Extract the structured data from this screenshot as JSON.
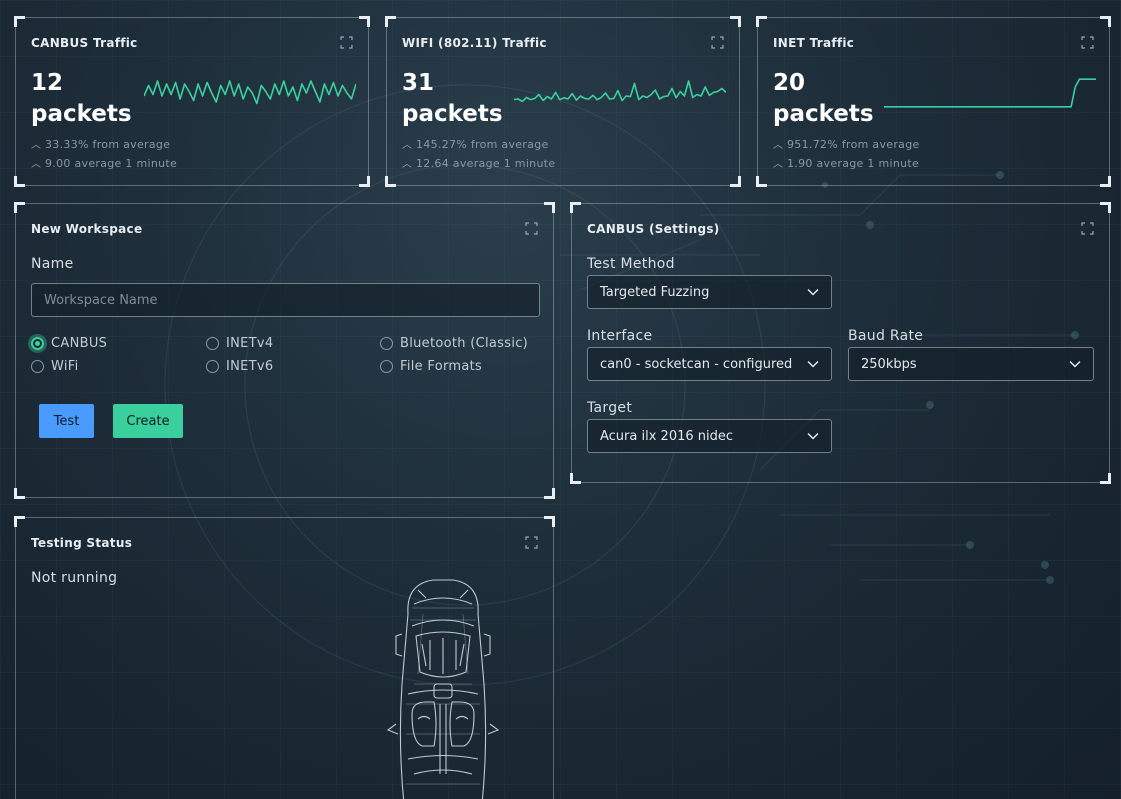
{
  "traffic_cards": [
    {
      "title": "CANBUS Traffic",
      "count": "12",
      "unit": "packets",
      "stat1": "33.33% from average",
      "stat2": "9.00 average 1 minute",
      "sparkline": [
        0.6,
        0.25,
        0.55,
        0.1,
        0.6,
        0.2,
        0.55,
        0.15,
        0.7,
        0.2,
        0.45,
        0.75,
        0.2,
        0.6,
        0.15,
        0.5,
        0.8,
        0.25,
        0.55,
        0.1,
        0.6,
        0.2,
        0.7,
        0.3,
        0.5,
        0.85,
        0.25,
        0.45,
        0.7,
        0.2,
        0.55,
        0.1,
        0.6,
        0.3,
        0.75,
        0.2,
        0.5,
        0.1,
        0.45,
        0.8,
        0.2,
        0.55,
        0.15,
        0.6,
        0.25,
        0.5,
        0.7,
        0.2
      ]
    },
    {
      "title": "WIFI (802.11) Traffic",
      "count": "31",
      "unit": "packets",
      "stat1": "145.27% from average",
      "stat2": "12.64 average 1 minute",
      "sparkline": [
        0.72,
        0.7,
        0.78,
        0.65,
        0.72,
        0.68,
        0.55,
        0.75,
        0.62,
        0.7,
        0.48,
        0.72,
        0.66,
        0.7,
        0.52,
        0.74,
        0.6,
        0.68,
        0.7,
        0.58,
        0.72,
        0.65,
        0.5,
        0.7,
        0.68,
        0.42,
        0.75,
        0.6,
        0.62,
        0.18,
        0.72,
        0.6,
        0.65,
        0.55,
        0.4,
        0.7,
        0.62,
        0.6,
        0.35,
        0.66,
        0.45,
        0.6,
        0.1,
        0.65,
        0.55,
        0.6,
        0.3,
        0.58,
        0.48,
        0.45,
        0.35,
        0.48
      ]
    },
    {
      "title": "INET Traffic",
      "count": "20",
      "unit": "packets",
      "stat1": "951.72% from average",
      "stat2": "1.90 average 1 minute",
      "sparkline": [
        0.96,
        0.96,
        0.96,
        0.96,
        0.96,
        0.96,
        0.96,
        0.96,
        0.96,
        0.96,
        0.96,
        0.96,
        0.96,
        0.96,
        0.96,
        0.96,
        0.96,
        0.96,
        0.96,
        0.96,
        0.96,
        0.96,
        0.96,
        0.96,
        0.96,
        0.96,
        0.96,
        0.96,
        0.96,
        0.96,
        0.96,
        0.96,
        0.96,
        0.96,
        0.96,
        0.96,
        0.96,
        0.96,
        0.96,
        0.96,
        0.96,
        0.96,
        0.96,
        0.96,
        0.96,
        0.96,
        0.3,
        0.04,
        0.04,
        0.04,
        0.04,
        0.04
      ]
    }
  ],
  "workspace": {
    "title": "New Workspace",
    "name_label": "Name",
    "name_placeholder": "Workspace Name",
    "name_value": "",
    "protocols": [
      {
        "label": "CANBUS",
        "checked": true
      },
      {
        "label": "INETv4",
        "checked": false
      },
      {
        "label": "Bluetooth (Classic)",
        "checked": false
      },
      {
        "label": "WiFi",
        "checked": false
      },
      {
        "label": "INETv6",
        "checked": false
      },
      {
        "label": "File Formats",
        "checked": false
      }
    ],
    "test_label": "Test",
    "create_label": "Create"
  },
  "settings": {
    "title": "CANBUS (Settings)",
    "test_method_label": "Test Method",
    "test_method_value": "Targeted Fuzzing",
    "interface_label": "Interface",
    "interface_value": "can0 - socketcan - configured",
    "baud_rate_label": "Baud Rate",
    "baud_rate_value": "250kbps",
    "target_label": "Target",
    "target_value": "Acura ilx 2016 nidec"
  },
  "status": {
    "title": "Testing Status",
    "text": "Not running"
  },
  "colors": {
    "accent_green": "#3ad09e",
    "accent_blue": "#4a9bff"
  }
}
